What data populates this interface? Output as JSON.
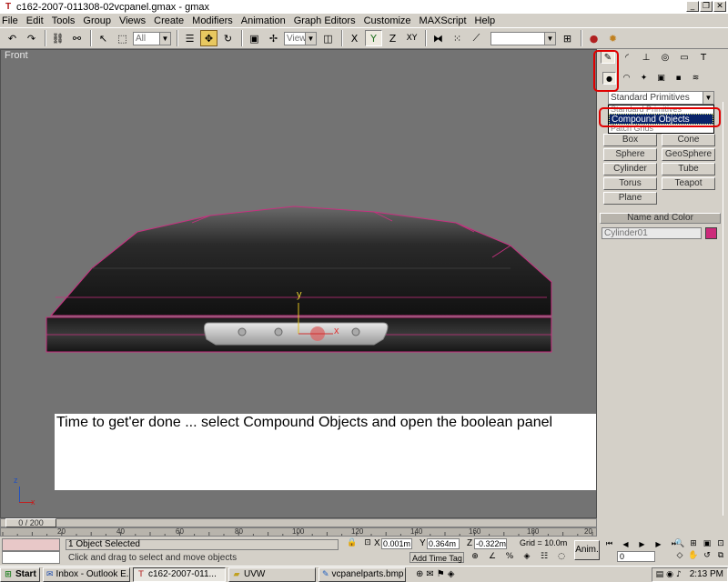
{
  "window": {
    "title": "c162-2007-011308-02vcpanel.gmax - gmax"
  },
  "menu": [
    "File",
    "Edit",
    "Tools",
    "Group",
    "Views",
    "Create",
    "Modifiers",
    "Animation",
    "Graph Editors",
    "Customize",
    "MAXScript",
    "Help"
  ],
  "toolbar": {
    "selection_filter": "All",
    "ref_coord": "View"
  },
  "viewport": {
    "label": "Front",
    "axis_y": "y",
    "axis_x": "x",
    "caption": "Time to get'er done ... select Compound Objects and open the boolean panel"
  },
  "command_panel": {
    "category_dropdown": "Standard Primitives",
    "dropdown_options": [
      "Standard Primitives",
      "Compound Objects",
      "Patch Grids"
    ],
    "selected_option": "Compound Objects",
    "buttons": [
      "Box",
      "Cone",
      "Sphere",
      "GeoSphere",
      "Cylinder",
      "Tube",
      "Torus",
      "Teapot",
      "Plane"
    ],
    "name_color_header": "Name and Color",
    "object_name": "Cylinder01",
    "object_color": "#cc2a7a"
  },
  "timeline": {
    "frame_counter": "0 / 200",
    "ticks": [
      "20",
      "40",
      "60",
      "80",
      "100",
      "120",
      "140",
      "160",
      "180",
      "20"
    ]
  },
  "status": {
    "selected": "1 Object Selected",
    "prompt": "Click and drag to select and move objects",
    "x": "0.001m",
    "y": "0.364m",
    "z": "-0.322m",
    "grid": "Grid = 10.0m",
    "add_time_tag": "Add Time Tag",
    "anim": "Anim.",
    "frame": "0"
  },
  "taskbar": {
    "start": "Start",
    "tasks": [
      "Inbox - Outlook E...",
      "c162-2007-011...",
      "UVW",
      "vcpanelparts.bmp ..."
    ],
    "clock": "2:13 PM"
  },
  "colors": {
    "viewport_bg": "#737373",
    "ui_face": "#d4d0c8",
    "selection_blue": "#0a246a",
    "highlight_red": "#e00000"
  }
}
